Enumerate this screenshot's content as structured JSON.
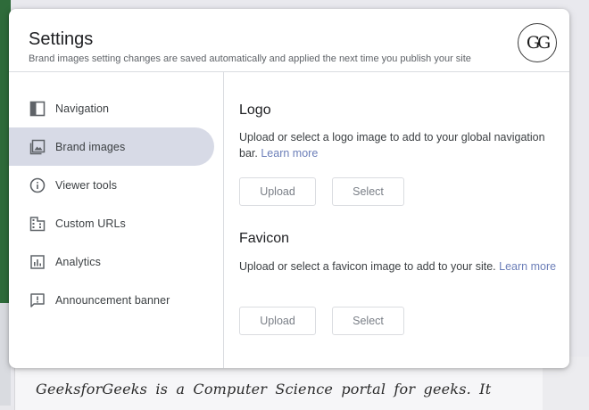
{
  "background": {
    "text": "GeeksforGeeks  is  a  Computer  Science  portal  for  geeks.  It"
  },
  "dialog": {
    "title": "Settings",
    "subtitle": "Brand images setting changes are saved automatically and applied the next time you publish your site",
    "logo_text": "GG"
  },
  "sidebar": {
    "items": [
      {
        "label": "Navigation",
        "icon": "navigation-layout-icon",
        "active": false
      },
      {
        "label": "Brand images",
        "icon": "image-icon",
        "active": true
      },
      {
        "label": "Viewer tools",
        "icon": "info-icon",
        "active": false
      },
      {
        "label": "Custom URLs",
        "icon": "domain-building-icon",
        "active": false
      },
      {
        "label": "Analytics",
        "icon": "analytics-chart-icon",
        "active": false
      },
      {
        "label": "Announcement banner",
        "icon": "announcement-icon",
        "active": false
      }
    ]
  },
  "main": {
    "logo": {
      "title": "Logo",
      "description": "Upload or select a logo image to add to your global navigation bar.",
      "link": "Learn more",
      "upload_label": "Upload",
      "select_label": "Select"
    },
    "favicon": {
      "title": "Favicon",
      "description": "Upload or select a favicon image to add to your site.",
      "link": "Learn more",
      "upload_label": "Upload",
      "select_label": "Select"
    }
  },
  "colors": {
    "active_item_bg": "#d7dae6",
    "link": "#6b7eb8",
    "accent_green": "#2e6b3a"
  }
}
